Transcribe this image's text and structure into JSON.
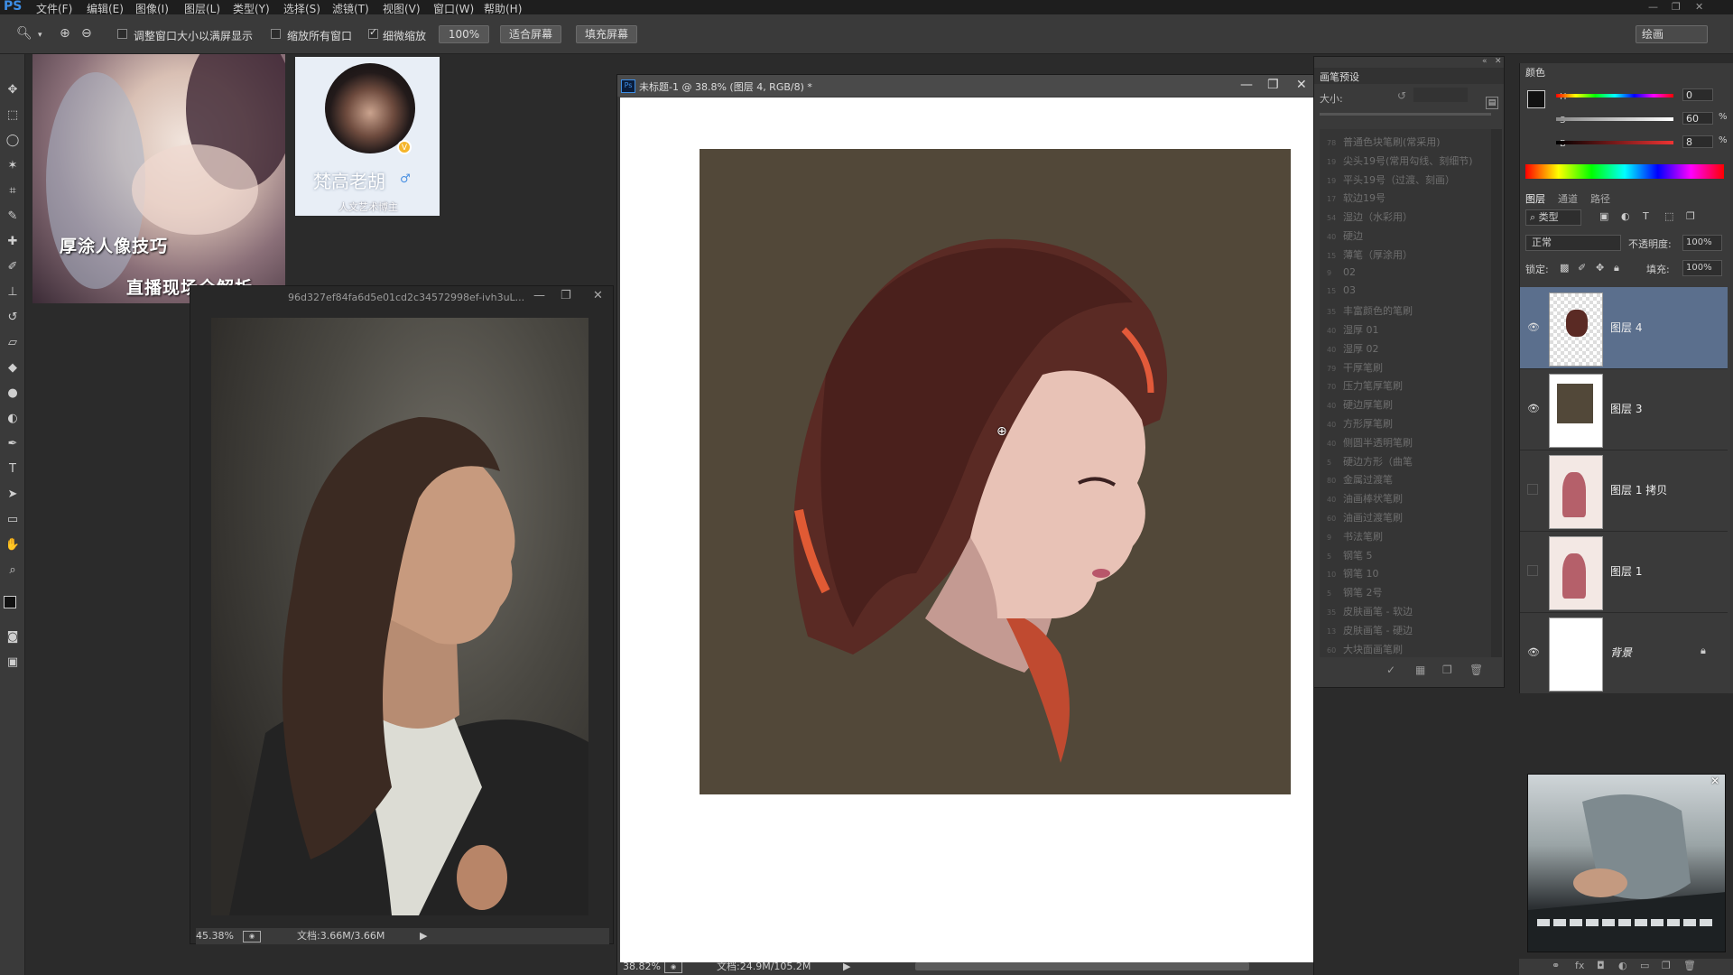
{
  "app": {
    "logo": "PS"
  },
  "menu": [
    "文件(F)",
    "编辑(E)",
    "图像(I)",
    "图层(L)",
    "类型(Y)",
    "选择(S)",
    "滤镜(T)",
    "视图(V)",
    "窗口(W)",
    "帮助(H)"
  ],
  "options": {
    "resize_windows": "调整窗口大小以满屏显示",
    "zoom_all_windows": "缩放所有窗口",
    "scrubby_zoom": "细微缩放",
    "btn_100": "100%",
    "btn_fit": "适合屏幕",
    "btn_fill": "填充屏幕",
    "workspace": "绘画"
  },
  "thumbnails": {
    "tutorial_line1": "厚涂人像技巧",
    "tutorial_line2": "直播现场全解析",
    "profile_name": "梵高老胡",
    "profile_subtitle": "人文艺术博主"
  },
  "reference_window": {
    "title": "96d327ef84fa6d5e01cd2c34572998ef-ivh3uL...",
    "zoom": "45.38%",
    "doc_size": "文档:3.66M/3.66M"
  },
  "main_window": {
    "title": "未标题-1 @ 38.8% (图层 4, RGB/8) *",
    "zoom": "38.82%",
    "doc_size": "文档:24.9M/105.2M"
  },
  "brush_panel": {
    "tab": "画笔预设",
    "size_label": "大小:",
    "brushes": [
      "普通色块笔刷(常采用)",
      "尖头19号(常用勾线、刻细节)",
      "平头19号（过渡、刻画）",
      "软边19号",
      "湿边（水彩用）",
      "硬边",
      "薄笔（厚涂用）",
      "02",
      "03",
      "丰富颜色的笔刷",
      "湿厚 01",
      "湿厚 02",
      "干厚笔刷",
      "压力笔厚笔刷",
      "硬边厚笔刷",
      "方形厚笔刷",
      "侧圆半透明笔刷",
      "硬边方形（曲笔",
      "金属过渡笔",
      "油画棒状笔刷",
      "油画过渡笔刷",
      "书法笔刷",
      "钢笔 5",
      "钢笔 10",
      "钢笔 2号",
      "皮肤画笔 - 软边",
      "皮肤画笔 - 硬边",
      "大块面画笔刷"
    ],
    "brush_numbers": [
      "78",
      "19",
      "19",
      "17",
      "54",
      "40",
      "15",
      "9",
      "15",
      "35",
      "40",
      "40",
      "79",
      "70",
      "40",
      "40",
      "40",
      "5",
      "80",
      "40",
      "60",
      "9",
      "5",
      "10",
      "5",
      "35",
      "13",
      "60"
    ]
  },
  "color_panel": {
    "tab": "颜色",
    "h_label": "H",
    "h_value": "0",
    "s_label": "S",
    "s_value": "60",
    "b_label": "B",
    "b_value": "8",
    "pct": "%",
    "fg_color": "#111111",
    "bg_color": "#1a3ad6"
  },
  "layers_panel": {
    "tabs": [
      "图层",
      "通道",
      "路径"
    ],
    "filter_label": "类型",
    "blend_mode": "正常",
    "opacity_label": "不透明度:",
    "opacity_value": "100%",
    "lock_label": "锁定:",
    "fill_label": "填充:",
    "fill_value": "100%",
    "layers": [
      {
        "name": "图层 4",
        "selected": true,
        "visible": true
      },
      {
        "name": "图层 3",
        "selected": false,
        "visible": true
      },
      {
        "name": "图层 1 拷贝",
        "selected": false,
        "visible": false
      },
      {
        "name": "图层 1",
        "selected": false,
        "visible": false
      },
      {
        "name": "背景",
        "selected": false,
        "visible": true,
        "locked": true
      }
    ]
  },
  "colors": {
    "panel_bg": "#3a3a3a",
    "painting_bg": "#524839",
    "selected_layer": "#5b6f8d"
  }
}
